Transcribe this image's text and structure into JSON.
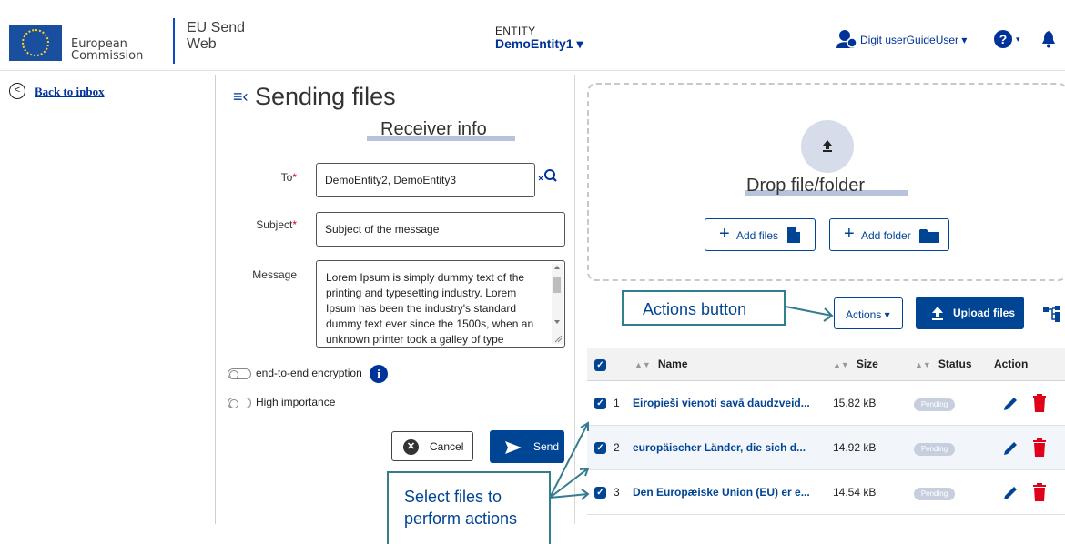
{
  "header": {
    "org_line1": "European",
    "org_line2": "Commission",
    "app_name_line1": "EU Send",
    "app_name_line2": "Web",
    "entity_caption": "ENTITY",
    "entity_name": "DemoEntity1 ▾",
    "user_name": "Digit userGuideUser ▾",
    "help_label": "?",
    "help_caret": "▾"
  },
  "nav": {
    "back_label": "Back to inbox"
  },
  "form": {
    "title": "Sending files",
    "section_title": "Receiver info",
    "to_label": "To",
    "to_value": "DemoEntity2, DemoEntity3",
    "subject_label": "Subject",
    "subject_placeholder": "Subject of the message",
    "required_mark": "*",
    "message_label": "Message",
    "message_value": "Lorem Ipsum is simply dummy text of the printing and typesetting industry. Lorem Ipsum has been the industry's standard dummy text ever since the 1500s, when an unknown printer took a galley of type",
    "encryption_label": "end-to-end encryption",
    "info_label": "i",
    "importance_label": "High importance",
    "cancel_label": "Cancel",
    "send_label": "Send"
  },
  "upload": {
    "drop_text": "Drop file/folder",
    "add_files_label": "Add files",
    "add_folder_label": "Add folder",
    "actions_label": "Actions ▾",
    "upload_files_label": "Upload files"
  },
  "callouts": {
    "actions_button": "Actions button",
    "select_files": "Select files to perform actions"
  },
  "table": {
    "columns": [
      "Name",
      "Size",
      "Status",
      "Action"
    ],
    "rows": [
      {
        "index": "1",
        "name": "Eiropieši vienoti savā daudzveid...",
        "size": "15.82 kB",
        "status": "Pending"
      },
      {
        "index": "2",
        "name": "europäischer Länder, die sich d...",
        "size": "14.92 kB",
        "status": "Pending"
      },
      {
        "index": "3",
        "name": "Den Europæiske Union (EU) er e...",
        "size": "14.54 kB",
        "status": "Pending"
      }
    ]
  },
  "colors": {
    "primary": "#004494",
    "accent_link": "#003399",
    "danger": "#e0001a",
    "callout_border": "#347c8f",
    "badge": "#c7cfde"
  },
  "icons": [
    "back-icon",
    "search-icon",
    "user-icon",
    "help-icon",
    "bell-icon",
    "upload-icon",
    "file-icon",
    "folder-icon",
    "tree-icon",
    "edit-icon",
    "delete-icon",
    "info-icon",
    "send-icon",
    "close-icon"
  ]
}
